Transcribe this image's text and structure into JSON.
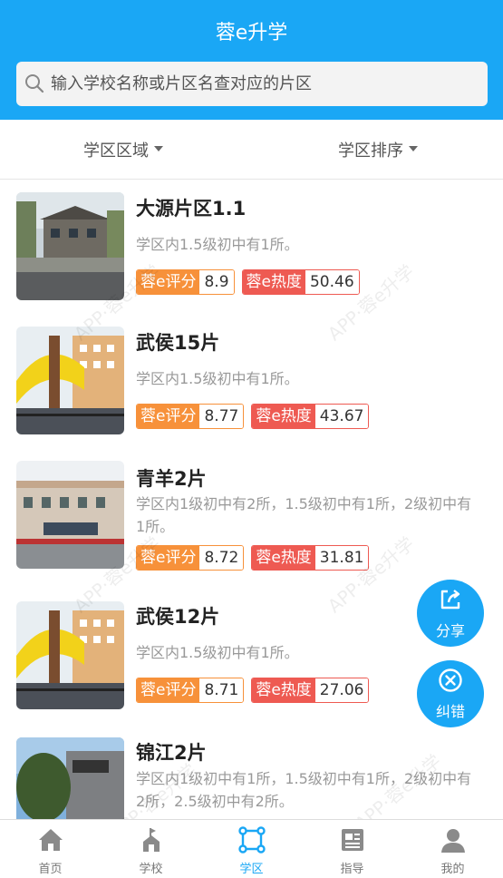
{
  "header": {
    "title": "蓉e升学"
  },
  "search": {
    "placeholder": "输入学校名称或片区名查对应的片区"
  },
  "filters": {
    "region": "学区区域",
    "sort": "学区排序"
  },
  "badges": {
    "score_label": "蓉e评分",
    "heat_label": "蓉e热度"
  },
  "items": [
    {
      "name": "大源片区1.1",
      "desc": "学区内1.5级初中有1所。",
      "score": "8.9",
      "heat": "50.46"
    },
    {
      "name": "武侯15片",
      "desc": "学区内1.5级初中有1所。",
      "score": "8.77",
      "heat": "43.67"
    },
    {
      "name": "青羊2片",
      "desc": "学区内1级初中有2所，1.5级初中有1所，2级初中有1所。",
      "score": "8.72",
      "heat": "31.81"
    },
    {
      "name": "武侯12片",
      "desc": "学区内1.5级初中有1所。",
      "score": "8.71",
      "heat": "27.06"
    },
    {
      "name": "锦江2片",
      "desc": "学区内1级初中有1所，1.5级初中有1所，2级初中有2所，2.5级初中有2所。",
      "score": "",
      "heat": ""
    }
  ],
  "watermark": "APP·蓉e升学",
  "fab": {
    "share": "分享",
    "correct": "纠错"
  },
  "tabs": [
    {
      "label": "首页",
      "icon": "home-icon"
    },
    {
      "label": "学校",
      "icon": "school-icon"
    },
    {
      "label": "学区",
      "icon": "district-icon"
    },
    {
      "label": "指导",
      "icon": "guide-icon"
    },
    {
      "label": "我的",
      "icon": "user-icon"
    }
  ],
  "colors": {
    "primary": "#1aa7f5",
    "score": "#f7913a",
    "heat": "#ee5a52"
  }
}
